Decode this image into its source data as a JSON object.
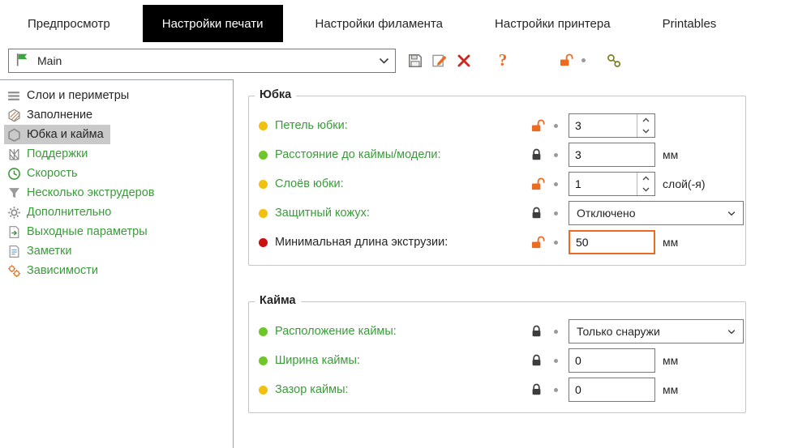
{
  "tabs": [
    {
      "name": "preview",
      "label": "Предпросмотр",
      "active": false
    },
    {
      "name": "print-settings",
      "label": "Настройки печати",
      "active": true
    },
    {
      "name": "filament-settings",
      "label": "Настройки филамента",
      "active": false
    },
    {
      "name": "printer-settings",
      "label": "Настройки принтера",
      "active": false
    },
    {
      "name": "printables",
      "label": "Printables",
      "active": false
    }
  ],
  "toolbar": {
    "preset_name": "Main",
    "help_glyph": "?",
    "icons": [
      "flag-icon",
      "save-icon",
      "edit-icon",
      "delete-icon",
      "question-icon",
      "unlock-icon",
      "compare-icon"
    ]
  },
  "sidebar": [
    {
      "name": "layers-perimeters",
      "icon": "layers",
      "label": "Слои и периметры",
      "color": "#262626",
      "selected": false
    },
    {
      "name": "infill",
      "icon": "infill",
      "label": "Заполнение",
      "color": "#262626",
      "selected": false
    },
    {
      "name": "skirt-brim",
      "icon": "skirt",
      "label": "Юбка и кайма",
      "color": "#262626",
      "selected": true
    },
    {
      "name": "supports",
      "icon": "supports",
      "label": "Поддержки",
      "color": "#3a9b3a",
      "selected": false
    },
    {
      "name": "speed",
      "icon": "speed",
      "label": "Скорость",
      "color": "#3a9b3a",
      "selected": false
    },
    {
      "name": "multiple-extruders",
      "icon": "extruders",
      "label": "Несколько экструдеров",
      "color": "#3a9b3a",
      "selected": false
    },
    {
      "name": "advanced",
      "icon": "advanced",
      "label": "Дополнительно",
      "color": "#3a9b3a",
      "selected": false
    },
    {
      "name": "output-options",
      "icon": "output",
      "label": "Выходные параметры",
      "color": "#3a9b3a",
      "selected": false
    },
    {
      "name": "notes",
      "icon": "notes",
      "label": "Заметки",
      "color": "#3a9b3a",
      "selected": false
    },
    {
      "name": "dependencies",
      "icon": "dependencies",
      "label": "Зависимости",
      "color": "#3a9b3a",
      "selected": false
    }
  ],
  "groups": [
    {
      "name": "skirt",
      "title": "Юбка",
      "rows": [
        {
          "dot": "#f2c011",
          "label": "Петель юбки:",
          "label_color": "#3a9b3a",
          "lock": "unlocked",
          "control": "spinner",
          "value": "3",
          "unit": "",
          "modified": false
        },
        {
          "dot": "#6fc52a",
          "label": "Расстояние до каймы/модели:",
          "label_color": "#3a9b3a",
          "lock": "locked",
          "control": "text",
          "value": "3",
          "unit": "мм",
          "modified": false
        },
        {
          "dot": "#f2c011",
          "label": "Слоёв юбки:",
          "label_color": "#3a9b3a",
          "lock": "unlocked",
          "control": "spinner",
          "value": "1",
          "unit": "слой(-я)",
          "modified": false
        },
        {
          "dot": "#f2c011",
          "label": "Защитный кожух:",
          "label_color": "#3a9b3a",
          "lock": "locked",
          "control": "select",
          "value": "Отключено",
          "unit": "",
          "modified": false
        },
        {
          "dot": "#cc1010",
          "label": "Минимальная длина экструзии:",
          "label_color": "#262626",
          "lock": "unlocked",
          "control": "text",
          "value": "50",
          "unit": "мм",
          "modified": true
        }
      ]
    },
    {
      "name": "brim",
      "title": "Кайма",
      "rows": [
        {
          "dot": "#6fc52a",
          "label": "Расположение каймы:",
          "label_color": "#3a9b3a",
          "lock": "locked",
          "control": "select",
          "value": "Только снаружи",
          "unit": "",
          "modified": false
        },
        {
          "dot": "#6fc52a",
          "label": "Ширина каймы:",
          "label_color": "#3a9b3a",
          "lock": "locked",
          "control": "text",
          "value": "0",
          "unit": "мм",
          "modified": false
        },
        {
          "dot": "#f2c011",
          "label": "Зазор каймы:",
          "label_color": "#3a9b3a",
          "lock": "locked",
          "control": "text",
          "value": "0",
          "unit": "мм",
          "modified": false
        }
      ]
    }
  ],
  "colors": {
    "accent_orange": "#ED6B21",
    "green_text": "#3a9b3a",
    "active_tab_bg": "#000000",
    "active_tab_fg": "#ffffff",
    "selected_item_bg": "#c9c9c9"
  }
}
